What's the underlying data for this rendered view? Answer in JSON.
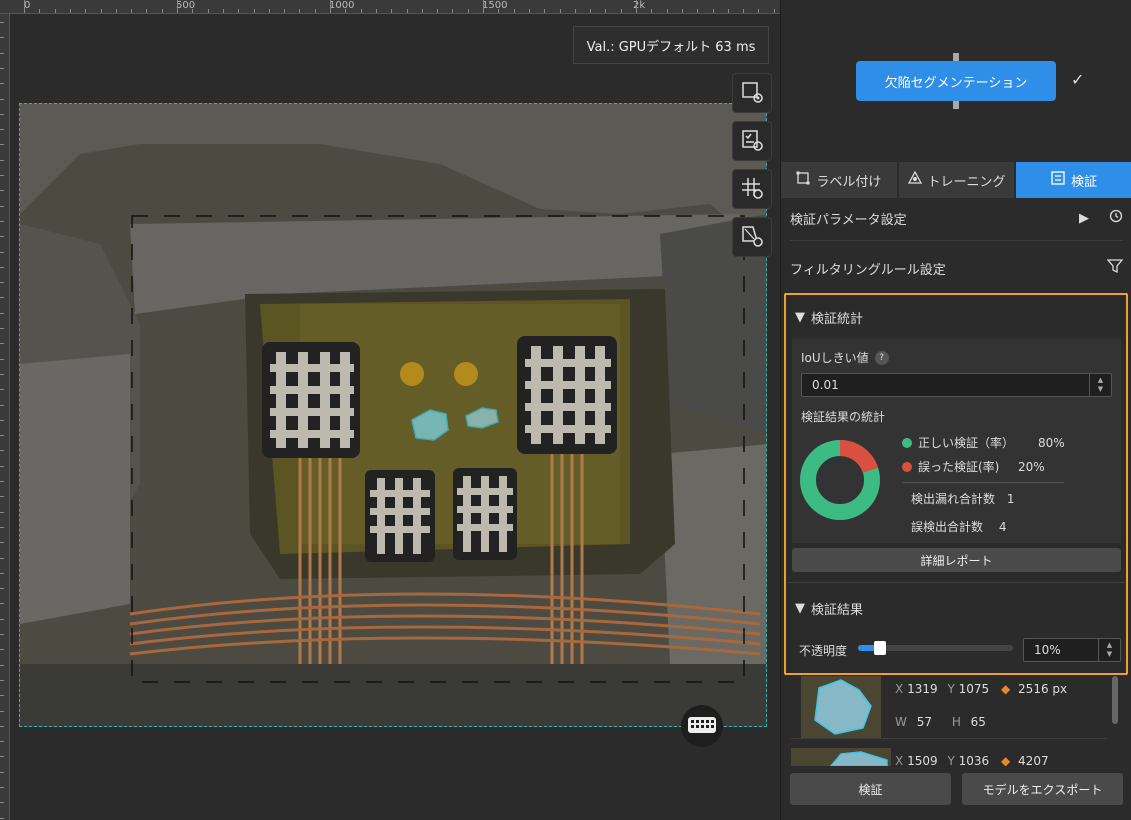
{
  "ruler": {
    "ticks": [
      "0",
      "500",
      "1000",
      "1500",
      "2k"
    ]
  },
  "canvas": {
    "val_badge": "Val.: GPUデフォルト 63 ms",
    "tools": [
      {
        "icon": "bbox-view-icon"
      },
      {
        "icon": "checklist-view-icon"
      },
      {
        "icon": "grid-view-icon"
      },
      {
        "icon": "mask-view-icon"
      }
    ],
    "keyboard_icon": "keyboard-icon"
  },
  "pipeline": {
    "step_label": "欠陥セグメンテーション",
    "status_icon": "check-icon"
  },
  "tabs": [
    {
      "label": "ラベル付け",
      "icon": "bbox-icon",
      "active": false
    },
    {
      "label": "トレーニング",
      "icon": "training-icon",
      "active": false
    },
    {
      "label": "検証",
      "icon": "validation-icon",
      "active": true
    }
  ],
  "settings": {
    "validation_params": "検証パラメータ設定",
    "filtering_rules": "フィルタリングルール設定"
  },
  "stats": {
    "title": "検証統計",
    "iou_label": "IoUしきい値",
    "iou_help": "?",
    "iou_value": "0.01",
    "results_title": "検証結果の統計",
    "correct_label": "正しい検証（率）",
    "correct_value": "80%",
    "wrong_label": "誤った検証(率)",
    "wrong_value": "20%",
    "missed_label": "検出漏れ合計数",
    "missed_value": "1",
    "false_label": "誤検出合計数",
    "false_value": "4",
    "detail_button": "詳細レポート",
    "correct_fraction": 0.8,
    "colors": {
      "correct": "#3dbb84",
      "wrong": "#d9503f"
    }
  },
  "results": {
    "title": "検証結果",
    "opacity_label": "不透明度",
    "opacity_value": "10%",
    "opacity_fraction": 0.1,
    "items": [
      {
        "x_label": "X",
        "x": "1319",
        "y_label": "Y",
        "y": "1075",
        "area": "2516 px",
        "w_label": "W",
        "w": "57",
        "h_label": "H",
        "h": "65"
      },
      {
        "x_label": "X",
        "x": "1509",
        "y_label": "Y",
        "y": "1036",
        "area": "4207"
      }
    ]
  },
  "footer": {
    "validate_button": "検証",
    "export_button": "モデルをエクスポート"
  }
}
